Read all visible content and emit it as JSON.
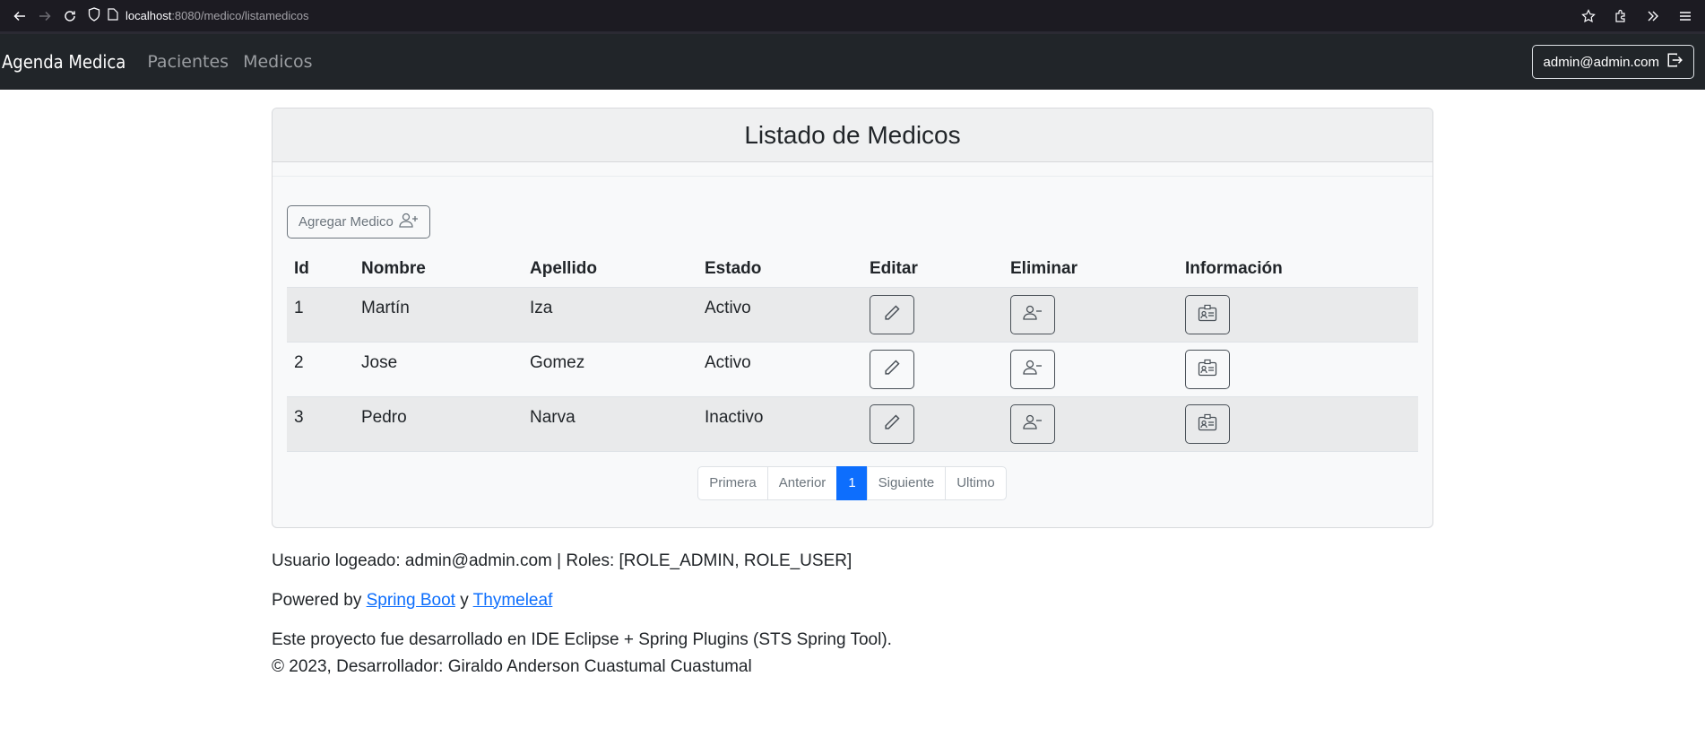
{
  "browser": {
    "url_host": "localhost",
    "url_path": ":8080/medico/listamedicos"
  },
  "navbar": {
    "brand": "Agenda Medica",
    "links": [
      "Pacientes",
      "Medicos"
    ],
    "user": "admin@admin.com"
  },
  "card": {
    "title": "Listado de Medicos",
    "add_button": "Agregar Medico"
  },
  "table": {
    "headers": [
      "Id",
      "Nombre",
      "Apellido",
      "Estado",
      "Editar",
      "Eliminar",
      "Información"
    ],
    "rows": [
      {
        "id": "1",
        "nombre": "Martín",
        "apellido": "Iza",
        "estado": "Activo"
      },
      {
        "id": "2",
        "nombre": "Jose",
        "apellido": "Gomez",
        "estado": "Activo"
      },
      {
        "id": "3",
        "nombre": "Pedro",
        "apellido": "Narva",
        "estado": "Inactivo"
      }
    ]
  },
  "pagination": {
    "items": [
      "Primera",
      "Anterior",
      "1",
      "Siguiente",
      "Ultimo"
    ],
    "active": "1"
  },
  "footer": {
    "user_line": "Usuario logeado: admin@admin.com | Roles: [ROLE_ADMIN, ROLE_USER]",
    "powered_prefix": "Powered by",
    "powered_link1": "Spring Boot",
    "powered_and": "y",
    "powered_link2": "Thymeleaf",
    "project_line": "Este proyecto fue desarrollado en IDE Eclipse + Spring Plugins (STS Spring Tool).",
    "copyright": "© 2023, Desarrollador: Giraldo Anderson Cuastumal Cuastumal"
  },
  "colors": {
    "navbar_bg": "#212529",
    "primary": "#0d6efd"
  }
}
